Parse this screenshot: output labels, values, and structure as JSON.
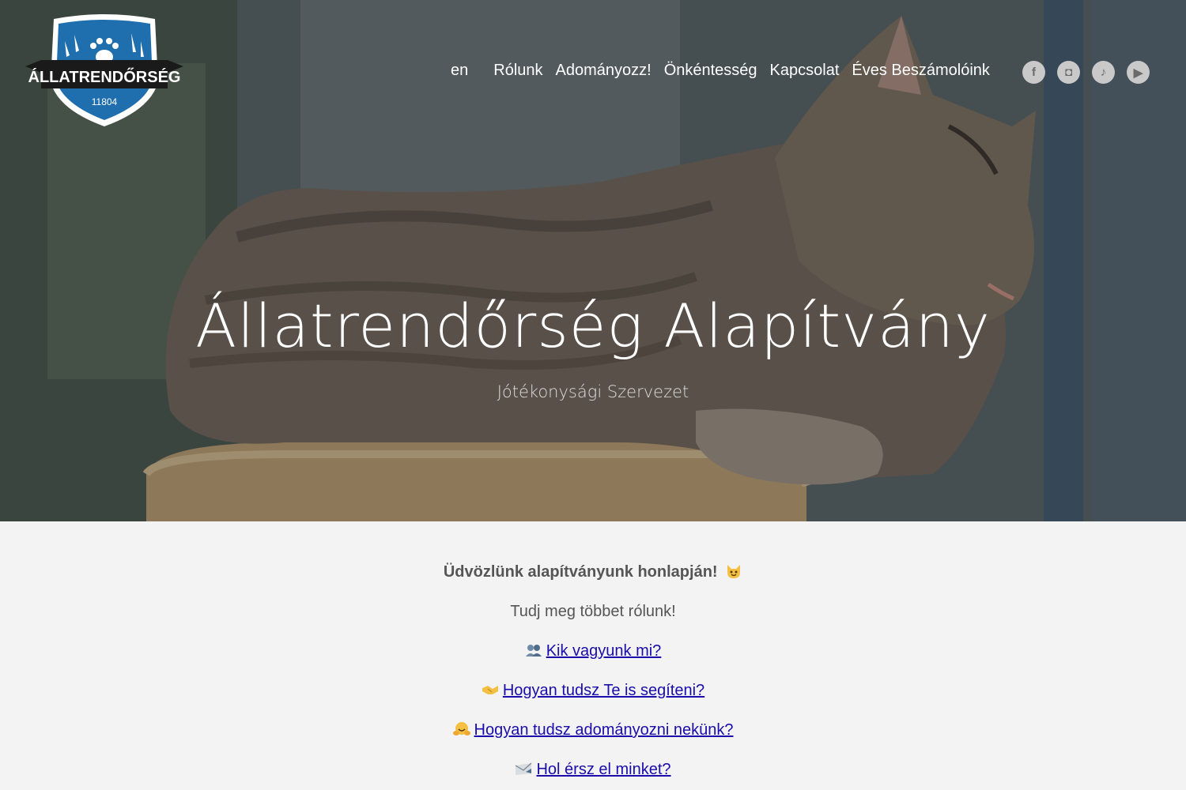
{
  "logo": {
    "name": "ÁLLATRENDŐRSÉG",
    "number": "11804",
    "colors": {
      "shield": "#1f6fae",
      "banner": "#1a1a1a",
      "border": "#ffffff"
    }
  },
  "nav": {
    "lang": "en",
    "items": [
      {
        "label": "Rólunk"
      },
      {
        "label": "Adományozz!"
      },
      {
        "label": "Önkéntesség"
      },
      {
        "label": "Kapcsolat"
      },
      {
        "label": "Éves Beszámolóink"
      }
    ]
  },
  "social": [
    {
      "icon": "facebook-icon",
      "glyph": "f"
    },
    {
      "icon": "instagram-icon",
      "glyph": "◘"
    },
    {
      "icon": "tiktok-icon",
      "glyph": "♪"
    },
    {
      "icon": "youtube-icon",
      "glyph": "▶"
    }
  ],
  "hero": {
    "title": "Állatrendőrség Alapítvány",
    "subtitle": "Jótékonysági Szervezet"
  },
  "content": {
    "welcome": "Üdvözlünk alapítványunk honlapján!",
    "learn_more": "Tudj meg többet rólunk!",
    "links": [
      {
        "icon": "people-icon",
        "label": "Kik vagyunk mi?"
      },
      {
        "icon": "handshake-icon",
        "label": "Hogyan tudsz Te is segíteni?"
      },
      {
        "icon": "hugging-face-icon",
        "label": "Hogyan tudsz adományozni nekünk?"
      },
      {
        "icon": "envelope-icon",
        "label": "Hol érsz el minket?"
      }
    ]
  }
}
